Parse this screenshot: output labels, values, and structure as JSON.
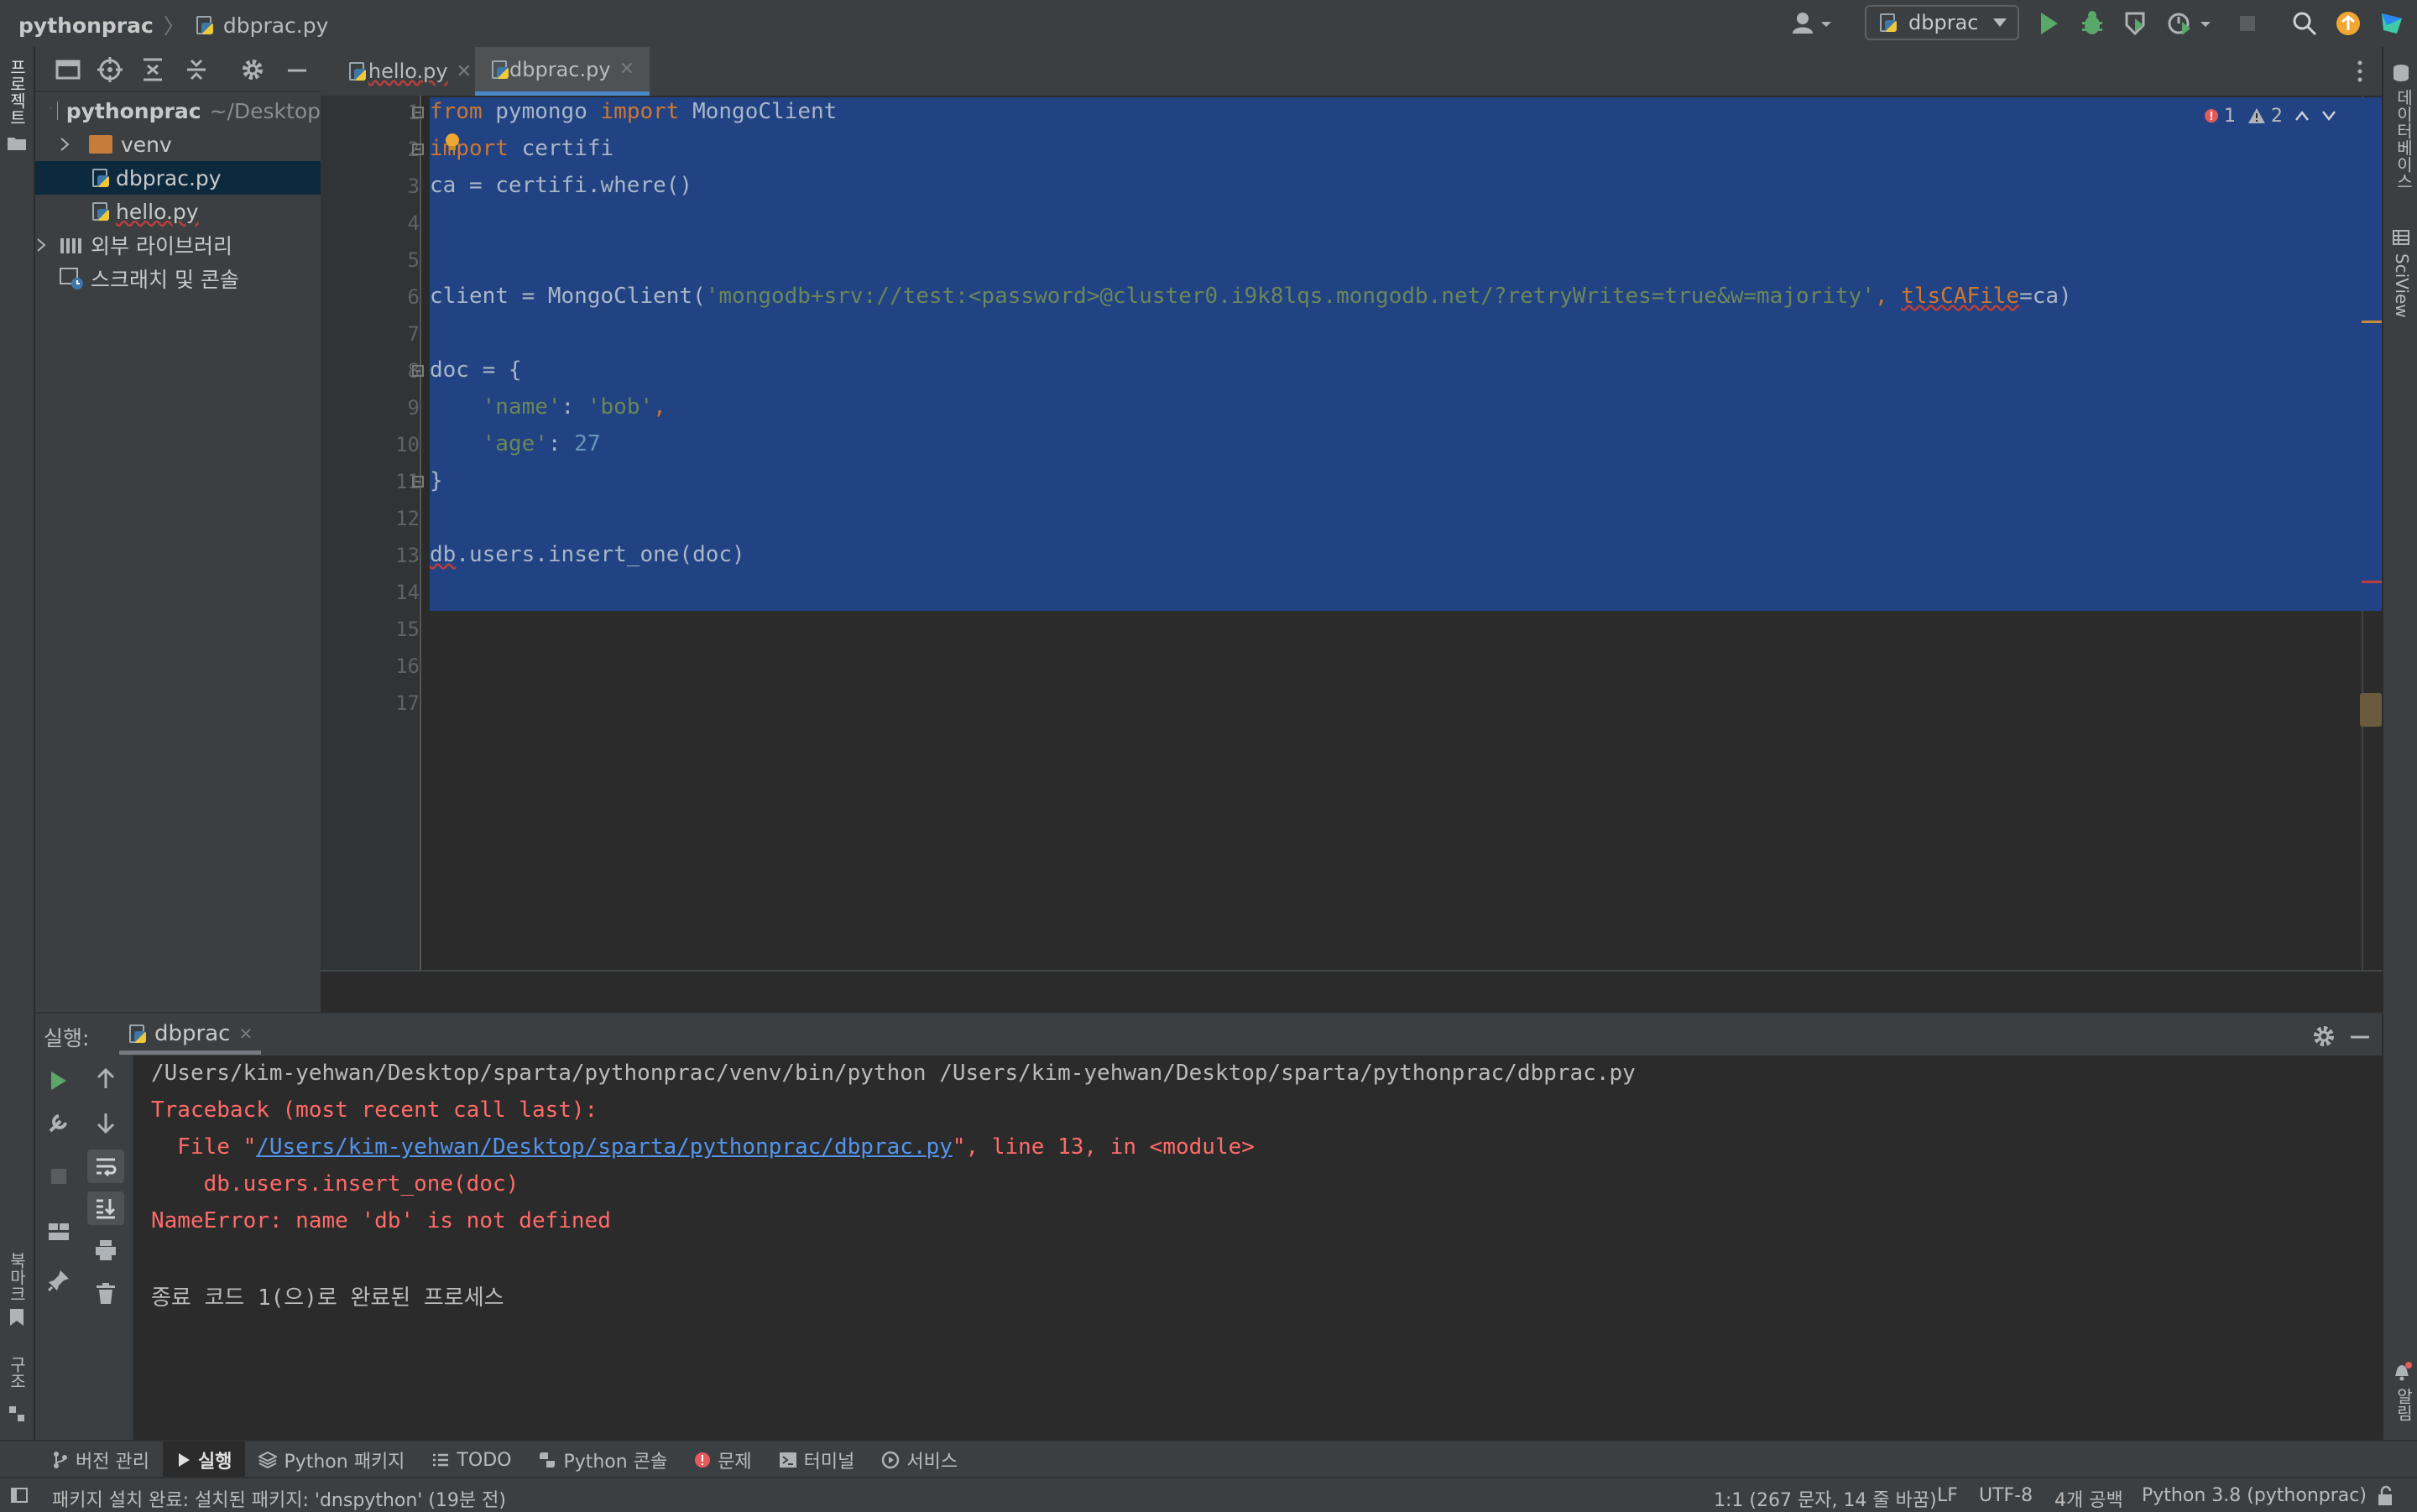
{
  "breadcrumb": {
    "project": "pythonprac",
    "file": "dbprac.py"
  },
  "run_config": {
    "label": "dbprac"
  },
  "left_strip": {
    "project_label": "프로젝트",
    "bookmarks_label": "북마크",
    "structure_label": "구조"
  },
  "right_strip": {
    "database_label": "데이터베이스",
    "sciview_label": "SciView",
    "notifications_label": "알림"
  },
  "project_tree": {
    "root": {
      "name": "pythonprac",
      "path": "~/Desktop"
    },
    "items": [
      {
        "label": "venv"
      },
      {
        "label": "dbprac.py"
      },
      {
        "label": "hello.py"
      },
      {
        "label": "외부 라이브러리"
      },
      {
        "label": "스크래치 및 콘솔"
      }
    ]
  },
  "editor": {
    "tabs": [
      {
        "label": "hello.py"
      },
      {
        "label": "dbprac.py"
      }
    ],
    "line_numbers": [
      "1",
      "2",
      "3",
      "4",
      "5",
      "6",
      "7",
      "8",
      "9",
      "10",
      "11",
      "12",
      "13",
      "14",
      "15",
      "16",
      "17"
    ],
    "code": {
      "l1": {
        "kw1": "from",
        "mod": " pymongo ",
        "kw2": "import",
        "rest": " MongoClient"
      },
      "l2": {
        "kw": "import",
        "rest": " certifi"
      },
      "l3": "ca = certifi.where()",
      "l6": {
        "pre": "client = MongoClient(",
        "str": "'mongodb+srv://test:<password>@cluster0.i9k8lqs.mongodb.net/?retryWrites=true&w=majority'",
        "comma": ", ",
        "param": "tlsCAFile",
        "post": "=ca)"
      },
      "l8": "doc = {",
      "l9": {
        "key": "'name'",
        "colon": ": ",
        "val": "'bob'",
        "comma": ","
      },
      "l10": {
        "key": "'age'",
        "colon": ": ",
        "val": "27"
      },
      "l11": "}",
      "l13": {
        "name": "db",
        "rest": ".users.insert_one(doc)"
      }
    },
    "errors_count": "1",
    "warnings_count": "2"
  },
  "run_panel": {
    "title": "실행:",
    "tab": "dbprac",
    "output": {
      "cmd": "/Users/kim-yehwan/Desktop/sparta/pythonprac/venv/bin/python /Users/kim-yehwan/Desktop/sparta/pythonprac/dbprac.py",
      "tb_header": "Traceback (most recent call last):",
      "file_pre": "  File \"",
      "file_link": "/Users/kim-yehwan/Desktop/sparta/pythonprac/dbprac.py",
      "file_post": "\", line 13, in <module>",
      "code_line": "    db.users.insert_one(doc)",
      "error": "NameError: name 'db' is not defined",
      "exit": "종료 코드 1(으)로 완료된 프로세스"
    }
  },
  "bottom_tabs": [
    {
      "label": "버전 관리"
    },
    {
      "label": "실행"
    },
    {
      "label": "Python 패키지"
    },
    {
      "label": "TODO"
    },
    {
      "label": "Python 콘솔"
    },
    {
      "label": "문제"
    },
    {
      "label": "터미널"
    },
    {
      "label": "서비스"
    }
  ],
  "status": {
    "message": "패키지 설치 완료: 설치된 패키지: 'dnspython' (19분 전)",
    "position": "1:1 (267 문자, 14 줄 바꿈)",
    "line_sep": "LF",
    "encoding": "UTF-8",
    "indent": "4개 공백",
    "interpreter": "Python 3.8 (pythonprac)"
  },
  "colors": {
    "selection": "#214283",
    "accent": "#4a88c7",
    "error": "#ff6b68",
    "run_green": "#59a869"
  }
}
